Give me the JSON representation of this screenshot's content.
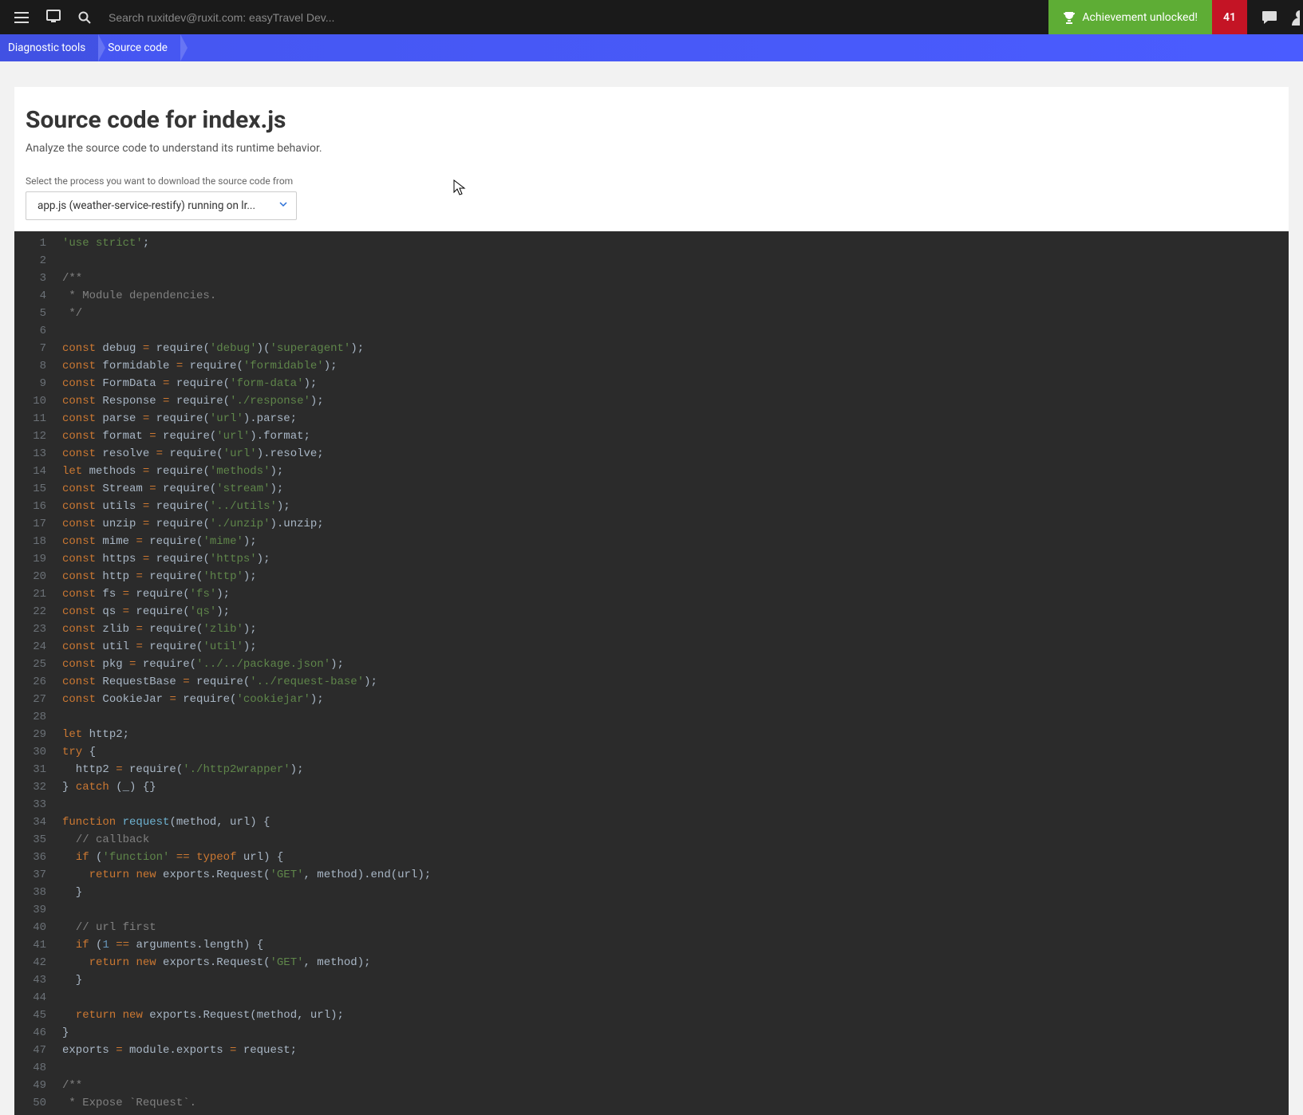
{
  "topbar": {
    "search_placeholder": "Search ruxitdev@ruxit.com: easyTravel Dev...",
    "achievement_label": "Achievement unlocked!",
    "notification_count": "41"
  },
  "breadcrumb": {
    "items": [
      "Diagnostic tools",
      "Source code"
    ]
  },
  "page": {
    "title": "Source code for index.js",
    "subtitle": "Analyze the source code to understand its runtime behavior.",
    "select_label": "Select the process you want to download the source code from",
    "selected_process": "app.js (weather-service-restify) running on lr..."
  },
  "code": {
    "first_line": 1,
    "lines": [
      [
        [
          "str",
          "'use strict'"
        ],
        [
          "id",
          ";"
        ]
      ],
      [],
      [
        [
          "cmt",
          "/**"
        ]
      ],
      [
        [
          "cmt",
          " * Module dependencies."
        ]
      ],
      [
        [
          "cmt",
          " */"
        ]
      ],
      [],
      [
        [
          "kw",
          "const"
        ],
        [
          "id",
          " debug "
        ],
        [
          "op",
          "="
        ],
        [
          "id",
          " require("
        ],
        [
          "str",
          "'debug'"
        ],
        [
          "id",
          ")("
        ],
        [
          "str",
          "'superagent'"
        ],
        [
          "id",
          ");"
        ]
      ],
      [
        [
          "kw",
          "const"
        ],
        [
          "id",
          " formidable "
        ],
        [
          "op",
          "="
        ],
        [
          "id",
          " require("
        ],
        [
          "str",
          "'formidable'"
        ],
        [
          "id",
          ");"
        ]
      ],
      [
        [
          "kw",
          "const"
        ],
        [
          "id",
          " FormData "
        ],
        [
          "op",
          "="
        ],
        [
          "id",
          " require("
        ],
        [
          "str",
          "'form-data'"
        ],
        [
          "id",
          ");"
        ]
      ],
      [
        [
          "kw",
          "const"
        ],
        [
          "id",
          " Response "
        ],
        [
          "op",
          "="
        ],
        [
          "id",
          " require("
        ],
        [
          "str",
          "'./response'"
        ],
        [
          "id",
          ");"
        ]
      ],
      [
        [
          "kw",
          "const"
        ],
        [
          "id",
          " parse "
        ],
        [
          "op",
          "="
        ],
        [
          "id",
          " require("
        ],
        [
          "str",
          "'url'"
        ],
        [
          "id",
          ").parse;"
        ]
      ],
      [
        [
          "kw",
          "const"
        ],
        [
          "id",
          " format "
        ],
        [
          "op",
          "="
        ],
        [
          "id",
          " require("
        ],
        [
          "str",
          "'url'"
        ],
        [
          "id",
          ").format;"
        ]
      ],
      [
        [
          "kw",
          "const"
        ],
        [
          "id",
          " resolve "
        ],
        [
          "op",
          "="
        ],
        [
          "id",
          " require("
        ],
        [
          "str",
          "'url'"
        ],
        [
          "id",
          ").resolve;"
        ]
      ],
      [
        [
          "kw",
          "let"
        ],
        [
          "id",
          " methods "
        ],
        [
          "op",
          "="
        ],
        [
          "id",
          " require("
        ],
        [
          "str",
          "'methods'"
        ],
        [
          "id",
          ");"
        ]
      ],
      [
        [
          "kw",
          "const"
        ],
        [
          "id",
          " Stream "
        ],
        [
          "op",
          "="
        ],
        [
          "id",
          " require("
        ],
        [
          "str",
          "'stream'"
        ],
        [
          "id",
          ");"
        ]
      ],
      [
        [
          "kw",
          "const"
        ],
        [
          "id",
          " utils "
        ],
        [
          "op",
          "="
        ],
        [
          "id",
          " require("
        ],
        [
          "str",
          "'../utils'"
        ],
        [
          "id",
          ");"
        ]
      ],
      [
        [
          "kw",
          "const"
        ],
        [
          "id",
          " unzip "
        ],
        [
          "op",
          "="
        ],
        [
          "id",
          " require("
        ],
        [
          "str",
          "'./unzip'"
        ],
        [
          "id",
          ").unzip;"
        ]
      ],
      [
        [
          "kw",
          "const"
        ],
        [
          "id",
          " mime "
        ],
        [
          "op",
          "="
        ],
        [
          "id",
          " require("
        ],
        [
          "str",
          "'mime'"
        ],
        [
          "id",
          ");"
        ]
      ],
      [
        [
          "kw",
          "const"
        ],
        [
          "id",
          " https "
        ],
        [
          "op",
          "="
        ],
        [
          "id",
          " require("
        ],
        [
          "str",
          "'https'"
        ],
        [
          "id",
          ");"
        ]
      ],
      [
        [
          "kw",
          "const"
        ],
        [
          "id",
          " http "
        ],
        [
          "op",
          "="
        ],
        [
          "id",
          " require("
        ],
        [
          "str",
          "'http'"
        ],
        [
          "id",
          ");"
        ]
      ],
      [
        [
          "kw",
          "const"
        ],
        [
          "id",
          " fs "
        ],
        [
          "op",
          "="
        ],
        [
          "id",
          " require("
        ],
        [
          "str",
          "'fs'"
        ],
        [
          "id",
          ");"
        ]
      ],
      [
        [
          "kw",
          "const"
        ],
        [
          "id",
          " qs "
        ],
        [
          "op",
          "="
        ],
        [
          "id",
          " require("
        ],
        [
          "str",
          "'qs'"
        ],
        [
          "id",
          ");"
        ]
      ],
      [
        [
          "kw",
          "const"
        ],
        [
          "id",
          " zlib "
        ],
        [
          "op",
          "="
        ],
        [
          "id",
          " require("
        ],
        [
          "str",
          "'zlib'"
        ],
        [
          "id",
          ");"
        ]
      ],
      [
        [
          "kw",
          "const"
        ],
        [
          "id",
          " util "
        ],
        [
          "op",
          "="
        ],
        [
          "id",
          " require("
        ],
        [
          "str",
          "'util'"
        ],
        [
          "id",
          ");"
        ]
      ],
      [
        [
          "kw",
          "const"
        ],
        [
          "id",
          " pkg "
        ],
        [
          "op",
          "="
        ],
        [
          "id",
          " require("
        ],
        [
          "str",
          "'../../package.json'"
        ],
        [
          "id",
          ");"
        ]
      ],
      [
        [
          "kw",
          "const"
        ],
        [
          "id",
          " RequestBase "
        ],
        [
          "op",
          "="
        ],
        [
          "id",
          " require("
        ],
        [
          "str",
          "'../request-base'"
        ],
        [
          "id",
          ");"
        ]
      ],
      [
        [
          "kw",
          "const"
        ],
        [
          "id",
          " CookieJar "
        ],
        [
          "op",
          "="
        ],
        [
          "id",
          " require("
        ],
        [
          "str",
          "'cookiejar'"
        ],
        [
          "id",
          ");"
        ]
      ],
      [],
      [
        [
          "kw",
          "let"
        ],
        [
          "id",
          " http2;"
        ]
      ],
      [
        [
          "kw",
          "try"
        ],
        [
          "id",
          " {"
        ]
      ],
      [
        [
          "id",
          "  http2 "
        ],
        [
          "op",
          "="
        ],
        [
          "id",
          " require("
        ],
        [
          "str",
          "'./http2wrapper'"
        ],
        [
          "id",
          ");"
        ]
      ],
      [
        [
          "id",
          "} "
        ],
        [
          "kw",
          "catch"
        ],
        [
          "id",
          " (_) {}"
        ]
      ],
      [],
      [
        [
          "kw",
          "function"
        ],
        [
          "id",
          " "
        ],
        [
          "fn",
          "request"
        ],
        [
          "id",
          "(method, url) {"
        ]
      ],
      [
        [
          "id",
          "  "
        ],
        [
          "cmt",
          "// callback"
        ]
      ],
      [
        [
          "id",
          "  "
        ],
        [
          "kw",
          "if"
        ],
        [
          "id",
          " ("
        ],
        [
          "str",
          "'function'"
        ],
        [
          "id",
          " "
        ],
        [
          "op",
          "=="
        ],
        [
          "id",
          " "
        ],
        [
          "kw",
          "typeof"
        ],
        [
          "id",
          " url) {"
        ]
      ],
      [
        [
          "id",
          "    "
        ],
        [
          "kw",
          "return"
        ],
        [
          "id",
          " "
        ],
        [
          "kw",
          "new"
        ],
        [
          "id",
          " exports.Request("
        ],
        [
          "str",
          "'GET'"
        ],
        [
          "id",
          ", method).end(url);"
        ]
      ],
      [
        [
          "id",
          "  }"
        ]
      ],
      [],
      [
        [
          "id",
          "  "
        ],
        [
          "cmt",
          "// url first"
        ]
      ],
      [
        [
          "id",
          "  "
        ],
        [
          "kw",
          "if"
        ],
        [
          "id",
          " ("
        ],
        [
          "num",
          "1"
        ],
        [
          "id",
          " "
        ],
        [
          "op",
          "=="
        ],
        [
          "id",
          " arguments.length) {"
        ]
      ],
      [
        [
          "id",
          "    "
        ],
        [
          "kw",
          "return"
        ],
        [
          "id",
          " "
        ],
        [
          "kw",
          "new"
        ],
        [
          "id",
          " exports.Request("
        ],
        [
          "str",
          "'GET'"
        ],
        [
          "id",
          ", method);"
        ]
      ],
      [
        [
          "id",
          "  }"
        ]
      ],
      [],
      [
        [
          "id",
          "  "
        ],
        [
          "kw",
          "return"
        ],
        [
          "id",
          " "
        ],
        [
          "kw",
          "new"
        ],
        [
          "id",
          " exports.Request(method, url);"
        ]
      ],
      [
        [
          "id",
          "}"
        ]
      ],
      [
        [
          "id",
          "exports "
        ],
        [
          "op",
          "="
        ],
        [
          "id",
          " module.exports "
        ],
        [
          "op",
          "="
        ],
        [
          "id",
          " request;"
        ]
      ],
      [],
      [
        [
          "cmt",
          "/**"
        ]
      ],
      [
        [
          "cmt",
          " * Expose `Request`."
        ]
      ]
    ]
  }
}
